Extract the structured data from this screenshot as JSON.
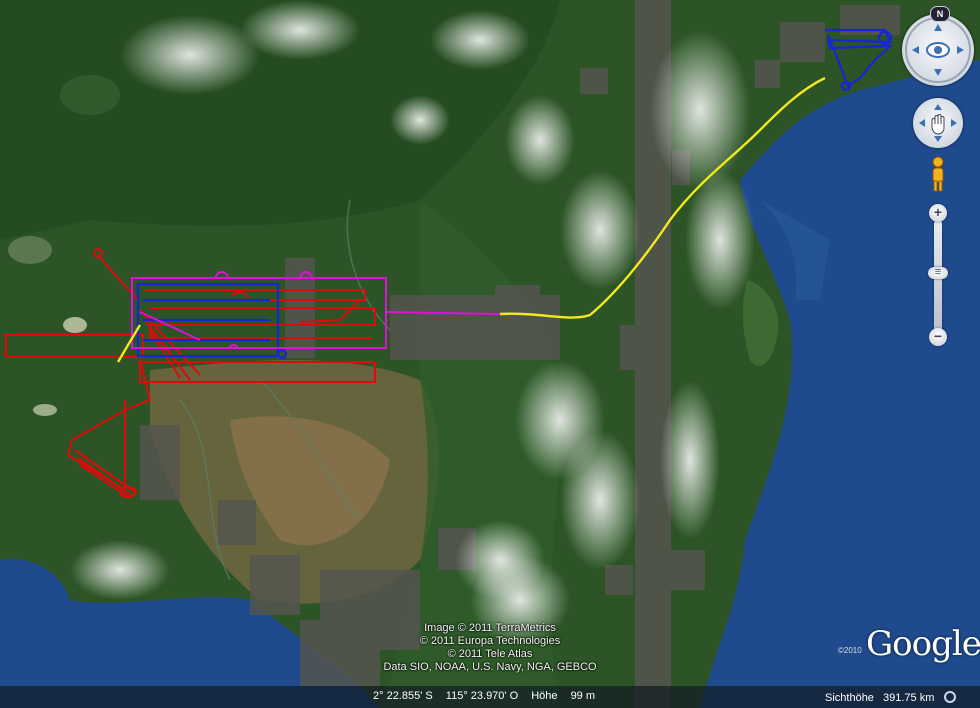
{
  "attribution": {
    "lines": [
      "Image © 2011 TerraMetrics",
      "© 2011 Europa Technologies",
      "© 2011 Tele Atlas",
      "Data SIO, NOAA, U.S. Navy, NGA, GEBCO"
    ]
  },
  "status": {
    "latitude": "2° 22.855' S",
    "longitude": "115° 23.970' O",
    "elevation_label": "Höhe",
    "elevation_value": "99 m",
    "eye_label": "Sichthöhe",
    "eye_value": "391.75 km"
  },
  "logo": {
    "copyright": "©2010",
    "brand": "Google"
  },
  "controls": {
    "compass_label": "N",
    "zoom_in_label": "+",
    "zoom_out_label": "−",
    "zoom_level": 0.45
  },
  "icons": {
    "look": "eye-icon",
    "move": "hand-icon",
    "streetview": "pegman-icon",
    "eye_altitude": "ring-icon"
  },
  "colors": {
    "track_red": "#e10a0a",
    "track_blue": "#1526d6",
    "track_magenta": "#e010d8",
    "track_yellow": "#f2ea1e",
    "sea": "#1e4a8c",
    "land": "#2f5a2a"
  }
}
